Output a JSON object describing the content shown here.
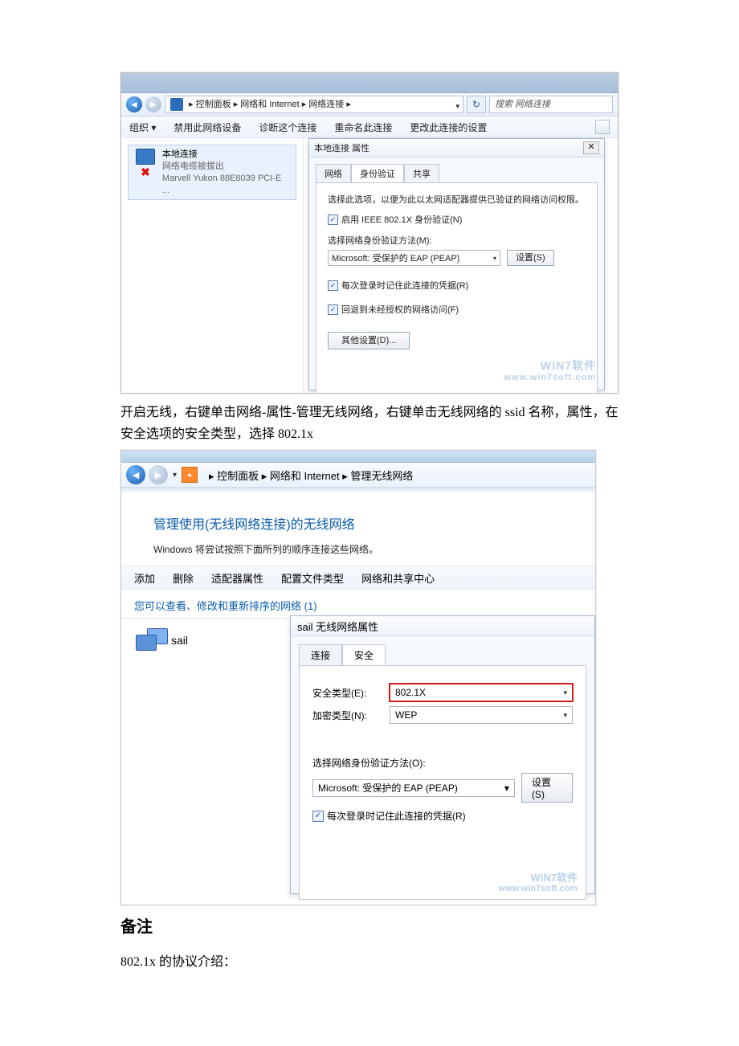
{
  "doc": {
    "para1": "开启无线，右键单击网络-属性-管理无线网络，右键单击无线网络的 ssid 名称，属性，在安全选项的安全类型，选择 802.1x",
    "notes_heading": "备注",
    "para2": "802.1x 的协议介绍："
  },
  "ss1": {
    "breadcrumb": "▸ 控制面板 ▸ 网络和 Internet ▸ 网络连接 ▸",
    "search_placeholder": "搜索 网络连接",
    "toolbar": {
      "org": "组织 ▾",
      "disable": "禁用此网络设备",
      "diagnose": "诊断这个连接",
      "rename": "重命名此连接",
      "change": "更改此连接的设置"
    },
    "conn": {
      "name": "本地连接",
      "status": "网络电缆被拔出",
      "adapter": "Marvell Yukon 88E8039 PCI-E ..."
    },
    "dlg": {
      "title": "本地连接 属性",
      "close": "✕",
      "tabs": {
        "t1": "网络",
        "t2": "身份验证",
        "t3": "共享"
      },
      "hint": "选择此选项，以便为此以太网适配器提供已验证的网络访问权限。",
      "enable_8021x": "启用 IEEE 802.1X 身份验证(N)",
      "method_label": "选择网络身份验证方法(M):",
      "method_value": "Microsoft: 受保护的 EAP (PEAP)",
      "settings_btn": "设置(S)",
      "remember": "每次登录时记住此连接的凭据(R)",
      "fallback": "回退到未经授权的网络访问(F)",
      "other_btn": "其他设置(D)...",
      "wm1": "WIN7软件",
      "wm2": "www.win7soft.com"
    }
  },
  "ss2": {
    "breadcrumb": "▸ 控制面板 ▸ 网络和 Internet ▸ 管理无线网络",
    "heading": "管理使用(无线网络连接)的无线网络",
    "sub": "Windows 将尝试按照下面所列的顺序连接这些网络。",
    "toolbar": {
      "add": "添加",
      "del": "删除",
      "adapter": "适配器属性",
      "profile": "配置文件类型",
      "center": "网络和共享中心"
    },
    "section": "您可以查看、修改和重新排序的网络 (1)",
    "item_name": "sail",
    "dlg": {
      "title": "sail 无线网络属性",
      "tabs": {
        "t1": "连接",
        "t2": "安全"
      },
      "sec_label": "安全类型(E):",
      "sec_value": "802.1X",
      "enc_label": "加密类型(N):",
      "enc_value": "WEP",
      "method_label": "选择网络身份验证方法(O):",
      "method_value": "Microsoft: 受保护的 EAP (PEAP)",
      "settings_btn": "设置(S)",
      "remember": "每次登录时记住此连接的凭据(R)",
      "wm1": "WIN7软件",
      "wm2": "www.win7soft.com"
    }
  }
}
